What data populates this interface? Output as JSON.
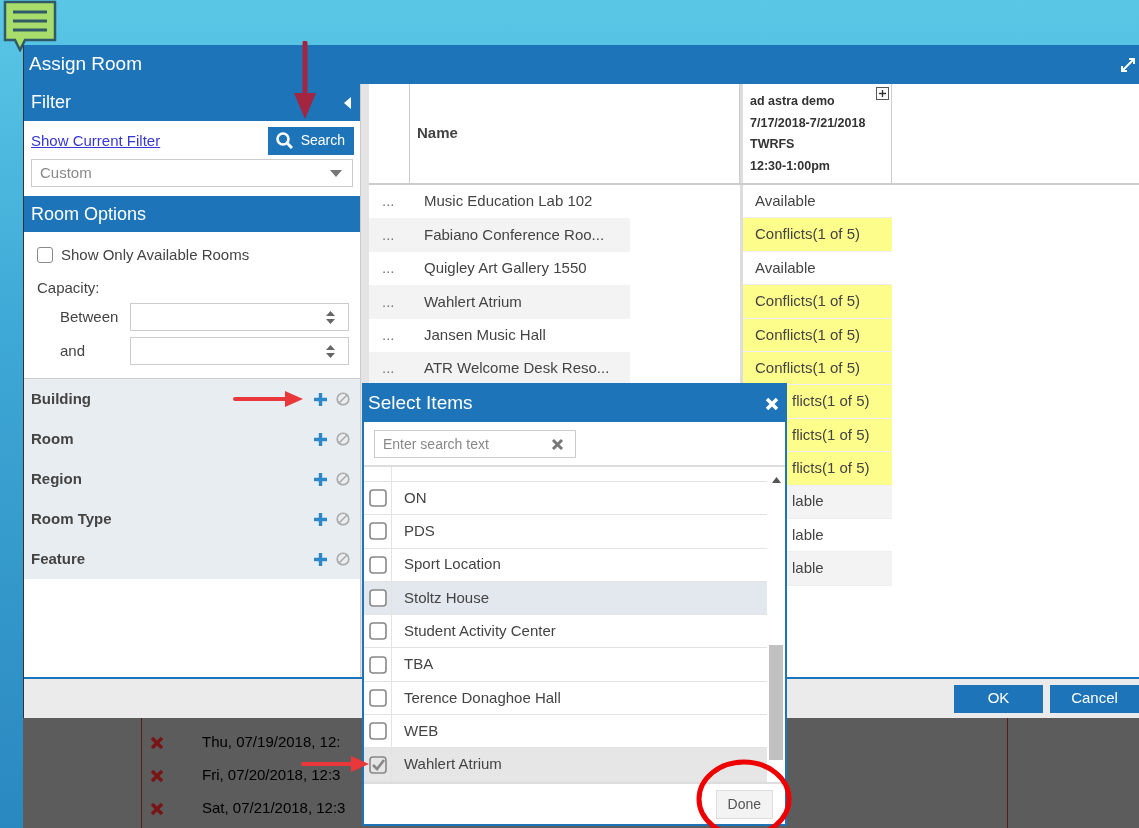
{
  "window": {
    "title": "Assign Room"
  },
  "filter": {
    "title": "Filter",
    "show_filter_link": "Show Current Filter",
    "search_button": "Search",
    "preset": "Custom"
  },
  "room_options": {
    "title": "Room Options",
    "only_available": {
      "label": "Show Only Available Rooms",
      "checked": false
    },
    "capacity_label": "Capacity:",
    "between_label": "Between",
    "and_label": "and"
  },
  "criteria": [
    {
      "label": "Building"
    },
    {
      "label": "Room"
    },
    {
      "label": "Region"
    },
    {
      "label": "Room Type"
    },
    {
      "label": "Feature"
    }
  ],
  "table": {
    "name_column": "Name",
    "event_column": [
      "ad astra demo",
      "7/17/2018-7/21/2018",
      "TWRFS",
      "12:30-1:00pm"
    ],
    "rows": [
      {
        "dots": "...",
        "name": "Music Education Lab 102",
        "status": "Available",
        "kind": "available"
      },
      {
        "dots": "...",
        "name": "Fabiano Conference Roo...",
        "status": "Conflicts(1 of 5)",
        "kind": "conflict"
      },
      {
        "dots": "...",
        "name": "Quigley Art Gallery 1550",
        "status": "Available",
        "kind": "available"
      },
      {
        "dots": "...",
        "name": "Wahlert Atrium",
        "status": "Conflicts(1 of 5)",
        "kind": "conflict"
      },
      {
        "dots": "...",
        "name": "Jansen Music Hall",
        "status": "Conflicts(1 of 5)",
        "kind": "conflict"
      },
      {
        "dots": "...",
        "name": "ATR Welcome Desk Reso...",
        "status": "Conflicts(1 of 5)",
        "kind": "conflict"
      },
      {
        "status": "flicts(1 of 5)",
        "kind": "conflict"
      },
      {
        "status": "flicts(1 of 5)",
        "kind": "conflict"
      },
      {
        "status": "flicts(1 of 5)",
        "kind": "conflict"
      },
      {
        "status": "lable",
        "kind": "available"
      },
      {
        "status": "lable",
        "kind": "available"
      },
      {
        "status": "lable",
        "kind": "available"
      }
    ]
  },
  "footer_buttons": [
    "OK",
    "Cancel"
  ],
  "select_dialog": {
    "title": "Select Items",
    "search_placeholder": "Enter search text",
    "done_button": "Done",
    "items": [
      {
        "label": "ON",
        "checked": false,
        "hovered": false
      },
      {
        "label": "PDS",
        "checked": false,
        "hovered": false
      },
      {
        "label": "Sport Location",
        "checked": false,
        "hovered": false
      },
      {
        "label": "Stoltz House",
        "checked": false,
        "hovered": true
      },
      {
        "label": "Student Activity Center",
        "checked": false,
        "hovered": false
      },
      {
        "label": "TBA",
        "checked": false,
        "hovered": false
      },
      {
        "label": "Terence Donaghoe Hall",
        "checked": false,
        "hovered": false
      },
      {
        "label": "WEB",
        "checked": false,
        "hovered": false
      },
      {
        "label": "Wahlert Atrium",
        "checked": true,
        "hovered": false
      }
    ]
  },
  "background_rows": [
    {
      "text": "Thu, 07/19/2018, 12:"
    },
    {
      "text": "Fri, 07/20/2018, 12:3"
    },
    {
      "text": "Sat, 07/21/2018, 12:3"
    }
  ]
}
